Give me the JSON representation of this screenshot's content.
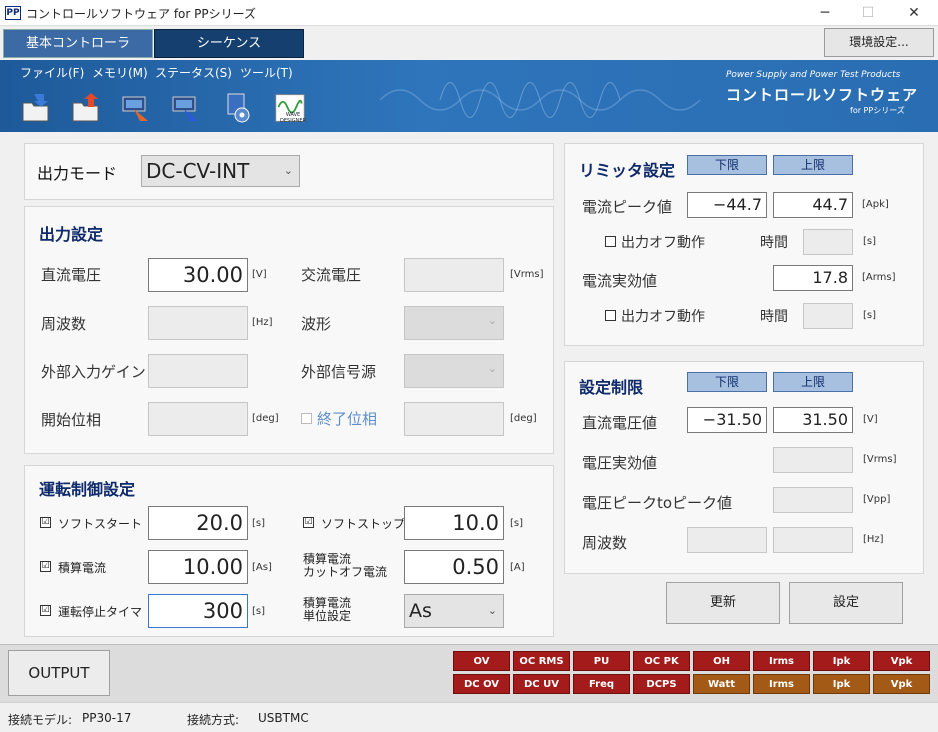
{
  "window": {
    "title": "コントロールソフトウェア for PPシリーズ",
    "icon": "PP",
    "minimize": "─",
    "maximize": "☐",
    "close": "✕"
  },
  "tabs": {
    "basic": "基本コントローラ",
    "sequence": "シーケンス",
    "env_settings": "環境設定..."
  },
  "menu": [
    "ファイル(F)",
    "メモリ(M)",
    "ステータス(S)",
    "ツール(T)"
  ],
  "brand": {
    "line1": "Power Supply and Power Test Products",
    "line2": "コントロールソフトウェア",
    "line3": "for PPシリーズ",
    "wave_designer": "WAVE DESIGNER"
  },
  "output_mode": {
    "label": "出力モード",
    "value": "DC-CV-INT"
  },
  "output_settings": {
    "title": "出力設定",
    "dc_voltage": {
      "label": "直流電圧",
      "value": "30.00",
      "unit": "[V]"
    },
    "ac_voltage": {
      "label": "交流電圧",
      "unit": "[Vrms]"
    },
    "frequency": {
      "label": "周波数",
      "unit": "[Hz]"
    },
    "waveform": {
      "label": "波形"
    },
    "ext_gain": {
      "label": "外部入力ゲイン"
    },
    "ext_source": {
      "label": "外部信号源"
    },
    "start_phase": {
      "label": "開始位相",
      "unit": "[deg]"
    },
    "end_phase": {
      "label": "終了位相",
      "unit": "[deg]"
    }
  },
  "operation": {
    "title": "運転制御設定",
    "soft_start": {
      "label": "ソフトスタート",
      "value": "20.0",
      "unit": "[s]"
    },
    "soft_stop": {
      "label": "ソフトストップ",
      "value": "10.0",
      "unit": "[s]"
    },
    "integ_current": {
      "label": "積算電流",
      "value": "10.00",
      "unit": "[As]"
    },
    "cutoff_current": {
      "label1": "積算電流",
      "label2": "カットオフ電流",
      "value": "0.50",
      "unit": "[A]"
    },
    "stop_timer": {
      "label": "運転停止タイマ",
      "value": "300",
      "unit": "[s]"
    },
    "unit_setting": {
      "label1": "積算電流",
      "label2": "単位設定",
      "value": "As"
    },
    "check": "☑"
  },
  "limiter": {
    "title": "リミッタ設定",
    "lower": "下限",
    "upper": "上限",
    "peak_current": {
      "label": "電流ピーク値",
      "lower": "−44.7",
      "upper": "44.7",
      "unit": "[Apk]"
    },
    "output_off1": {
      "label": "出力オフ動作",
      "time": "時間",
      "unit": "[s]"
    },
    "rms_current": {
      "label": "電流実効値",
      "value": "17.8",
      "unit": "[Arms]"
    },
    "output_off2": {
      "label": "出力オフ動作",
      "time": "時間",
      "unit": "[s]"
    }
  },
  "setting_limit": {
    "title": "設定制限",
    "lower": "下限",
    "upper": "上限",
    "dc_voltage": {
      "label": "直流電圧値",
      "lower": "−31.50",
      "upper": "31.50",
      "unit": "[V]"
    },
    "rms_voltage": {
      "label": "電圧実効値",
      "unit": "[Vrms]"
    },
    "pp_voltage": {
      "label": "電圧ピークtoピーク値",
      "unit": "[Vpp]"
    },
    "frequency": {
      "label": "周波数",
      "unit": "[Hz]"
    }
  },
  "buttons": {
    "update": "更新",
    "set": "設定",
    "output": "OUTPUT"
  },
  "indicators": {
    "row1": [
      "OV",
      "OC RMS",
      "PU",
      "OC PK",
      "OH",
      "Irms",
      "Ipk",
      "Vpk"
    ],
    "row2": [
      "DC OV",
      "DC UV",
      "Freq",
      "DCPS",
      "Watt",
      "Irms",
      "Ipk",
      "Vpk"
    ]
  },
  "status": {
    "model_label": "接続モデル:",
    "model": "PP30-17",
    "conn_label": "接続方式:",
    "conn": "USBTMC"
  },
  "colors": {
    "banner": "#2a6db2",
    "indicator_red": "#a41b1b",
    "indicator_brown": "#a35a16",
    "title_navy": "#0f2a6b"
  }
}
